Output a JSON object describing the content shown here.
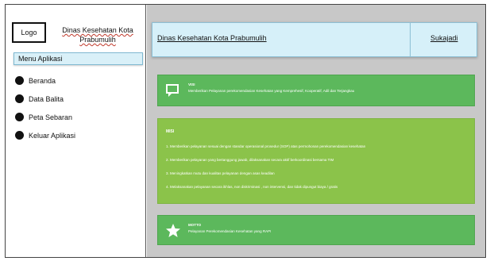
{
  "sidebar": {
    "logo_label": "Logo",
    "app_title": "Dinas Kesehatan Kota Prabumulih",
    "menu_header": "Menu Aplikasi",
    "items": [
      {
        "label": "Beranda"
      },
      {
        "label": "Data Balita"
      },
      {
        "label": "Peta Sebaran"
      },
      {
        "label": "Keluar Aplikasi"
      }
    ]
  },
  "header": {
    "title": "Dinas Kesehatan Kota Prabumulih",
    "location": "Sukajadi"
  },
  "visi": {
    "icon": "chat-bubble-icon",
    "label": "VISI",
    "text": "Memberikan Pelayanan perekomendasian Kesehatan yang Kemprehesif, Kooperatif, Adil dan Terjangkau"
  },
  "misi": {
    "title": "MISI",
    "items": [
      "1. Memberikan pelayanan sesuai dengan standar operasional prosedur (SOP) atas permohonan perekomendasian kesehatan",
      "2. Memberikan pelayanan yang bertanggung jawab, dilaksanakan secara aktif berkoordinasi bersama TIM",
      "3. Meningkatkan mutu dan kualitas pelayanan dengan asas keadilan",
      "4. Melaksanakan pelayanan secara ikhlas, non diskriminasi , non intervensi, dan tidak dipungut biaya / gratis"
    ]
  },
  "motto": {
    "icon": "star-icon",
    "label": "MOTTO",
    "text": "Pelayanan Perekomendasian Kesehatan yang RAPI"
  },
  "colors": {
    "card_green": "#5cb85c",
    "card_light_green": "#8bc34a",
    "header_bg": "#d6f0f9",
    "main_bg": "#c8c8c8"
  }
}
